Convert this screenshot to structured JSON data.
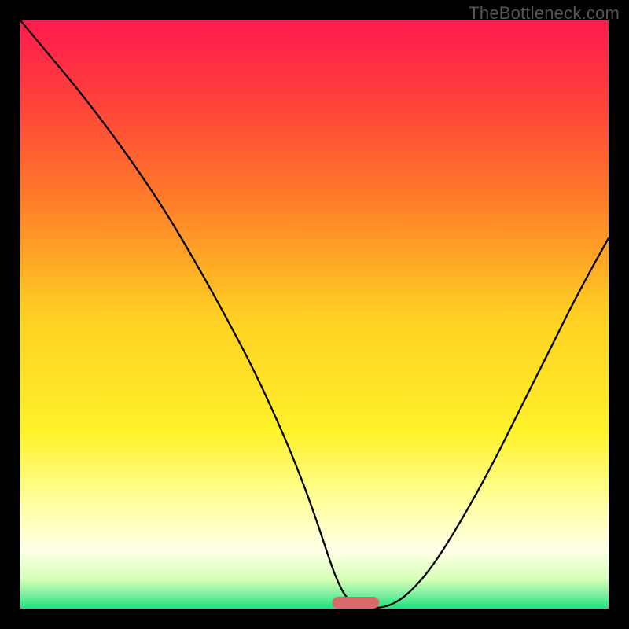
{
  "watermark": "TheBottleneck.com",
  "chart_data": {
    "type": "line",
    "title": "",
    "xlabel": "",
    "ylabel": "",
    "xlim": [
      0,
      100
    ],
    "ylim": [
      0,
      100
    ],
    "grid": false,
    "legend": false,
    "background": {
      "type": "vertical-gradient",
      "stops": [
        {
          "offset": 0.0,
          "color": "#ff1a50"
        },
        {
          "offset": 0.12,
          "color": "#ff3c3c"
        },
        {
          "offset": 0.3,
          "color": "#ff7a2a"
        },
        {
          "offset": 0.5,
          "color": "#ffcf22"
        },
        {
          "offset": 0.7,
          "color": "#fff22a"
        },
        {
          "offset": 0.82,
          "color": "#ffffa0"
        },
        {
          "offset": 0.9,
          "color": "#ffffe8"
        },
        {
          "offset": 0.95,
          "color": "#d8ffb8"
        },
        {
          "offset": 0.975,
          "color": "#80f0a0"
        },
        {
          "offset": 1.0,
          "color": "#1de27c"
        }
      ]
    },
    "series": [
      {
        "name": "bottleneck-curve",
        "color": "#000000",
        "width": 2.3,
        "x": [
          0,
          5,
          10,
          15,
          20,
          25,
          30,
          35,
          40,
          45,
          48,
          50,
          52,
          53,
          54,
          55,
          56,
          57,
          58,
          60,
          63,
          66,
          70,
          75,
          80,
          85,
          90,
          95,
          100
        ],
        "y": [
          100,
          94,
          88,
          81.5,
          74.5,
          67,
          58.5,
          49.5,
          40,
          29,
          21.5,
          16,
          10,
          7,
          4.5,
          2.5,
          1.3,
          0.6,
          0.2,
          0,
          0.5,
          2.5,
          7,
          15,
          24,
          34,
          44,
          54,
          63
        ]
      }
    ],
    "marker": {
      "name": "target-range",
      "shape": "capsule",
      "color": "#d86a6a",
      "x_center": 57,
      "y": 0,
      "width_x": 8,
      "height_y": 2
    }
  }
}
